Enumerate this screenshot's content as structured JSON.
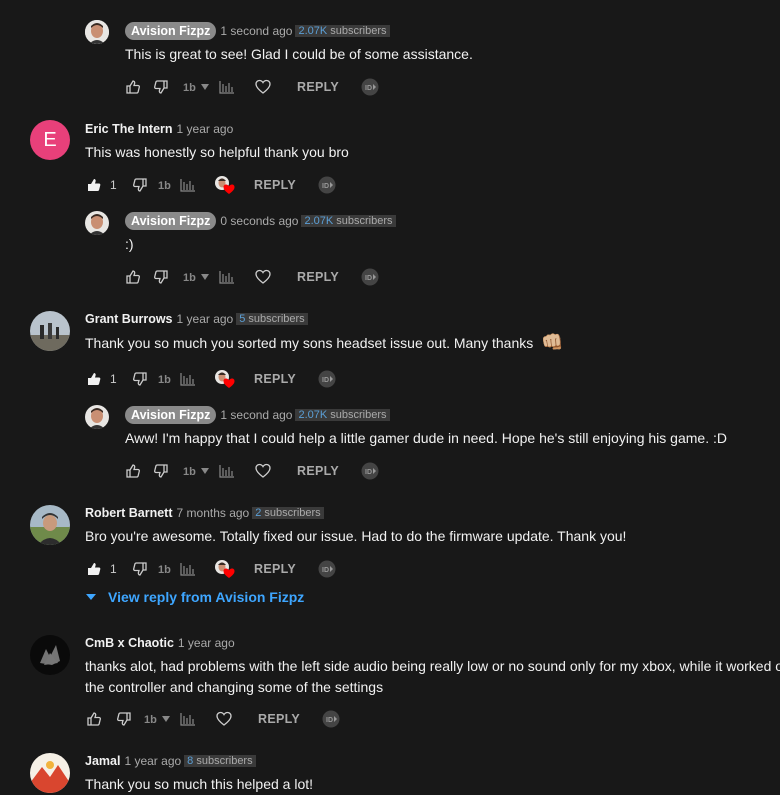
{
  "comments": [
    {
      "author": "Avision Fizpz",
      "time": "1 second ago",
      "subs_num": "2.07K",
      "subs_word": "subscribers",
      "text": "This is great to see! Glad I could be of some assistance.",
      "reply": "REPLY"
    },
    {
      "author": "Eric The Intern",
      "avatar_letter": "E",
      "time": "1 year ago",
      "text": "This was honestly so helpful thank you bro",
      "likes": "1",
      "reply": "REPLY"
    },
    {
      "author": "Avision Fizpz",
      "time": "0 seconds ago",
      "subs_num": "2.07K",
      "subs_word": "subscribers",
      "text": ":)",
      "reply": "REPLY"
    },
    {
      "author": "Grant Burrows",
      "time": "1 year ago",
      "subs_num": "5",
      "subs_word": "subscribers",
      "text": "Thank you so much you sorted my sons headset issue out. Many thanks",
      "emoji": "👊🏼",
      "likes": "1",
      "reply": "REPLY"
    },
    {
      "author": "Avision Fizpz",
      "time": "1 second ago",
      "subs_num": "2.07K",
      "subs_word": "subscribers",
      "text": "Aww! I'm happy that I could help a little gamer dude in need. Hope he's still enjoying his game. :D",
      "reply": "REPLY"
    },
    {
      "author": "Robert Barnett",
      "time": "7 months ago",
      "subs_num": "2",
      "subs_word": "subscribers",
      "text": "Bro you're awesome. Totally fixed our issue. Had to do the firmware update. Thank you!",
      "likes": "1",
      "reply": "REPLY"
    },
    {
      "author": "CmB x Chaotic",
      "time": "1 year ago",
      "text_line1": "thanks alot, had problems with the left side audio being really low or no sound only for my xbox, while it worked on",
      "text_line2": "the controller and changing some of the settings",
      "reply": "REPLY"
    },
    {
      "author": "Jamal",
      "time": "1 year ago",
      "subs_num": "8",
      "subs_word": "subscribers",
      "text": "Thank you so much this helped a lot!"
    }
  ],
  "view_reply": "View reply from Avision Fizpz",
  "colors": {
    "background": "#181818",
    "link": "#3ea6ff",
    "heart": "#ff0000",
    "eric_avatar": "#e8407a"
  }
}
